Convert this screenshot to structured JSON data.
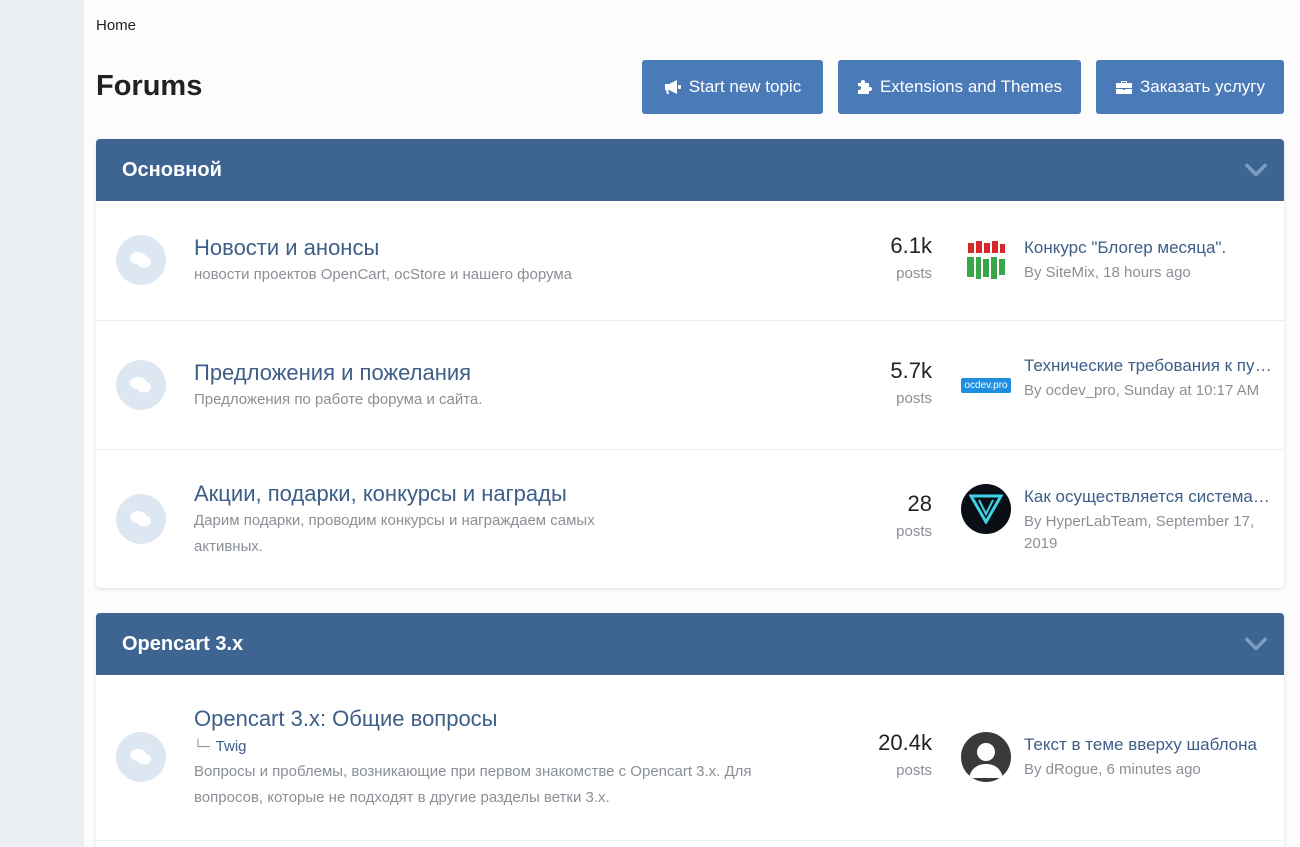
{
  "breadcrumb": "Home",
  "page_title": "Forums",
  "buttons": {
    "start_topic": "Start new topic",
    "extensions": "Extensions and Themes",
    "order": "Заказать услугу"
  },
  "categories": [
    {
      "title": "Основной",
      "forums": [
        {
          "title": "Новости и анонсы",
          "description": "новости проектов OpenCart, ocStore и нашего форума",
          "count": "6.1k",
          "count_label": "posts",
          "avatar": "sitemix-logo",
          "last_title": "Конкурс \"Блогер месяца\".",
          "last_meta": "By SiteMix, 18 hours ago"
        },
        {
          "title": "Предложения и пожелания",
          "description": "Предложения по работе форума и сайта.",
          "count": "5.7k",
          "count_label": "posts",
          "avatar": "ocdev-logo",
          "avatar_text": "ocdev.pro",
          "last_title": "Технические требования к публикации",
          "last_meta": "By ocdev_pro, Sunday at 10:17 AM"
        },
        {
          "title": "Акции, подарки, конкурсы и награды",
          "description": "Дарим подарки, проводим конкурсы и награждаем самых активных.",
          "count": "28",
          "count_label": "posts",
          "avatar": "hyperlab-logo",
          "last_title": "Как осуществляется система наград",
          "last_meta": "By HyperLabTeam, September 17, 2019"
        }
      ]
    },
    {
      "title": "Opencart 3.x",
      "forums": [
        {
          "title": "Opencart 3.x: Общие вопросы",
          "subforum": "Twig",
          "description": "Вопросы и проблемы, возникающие при первом знакомстве с Opencart 3.x. Для вопросов, которые не подходят в другие разделы ветки 3.x.",
          "count": "20.4k",
          "count_label": "posts",
          "avatar": "default-user-avatar",
          "last_title": "Текст в теме вверху шаблона",
          "last_meta": "By dRogue, 6 minutes ago"
        }
      ]
    }
  ],
  "colors": {
    "accent": "#4a7ab8",
    "category_header": "#3e6592",
    "link": "#3d5e87",
    "muted": "#8a9096"
  }
}
